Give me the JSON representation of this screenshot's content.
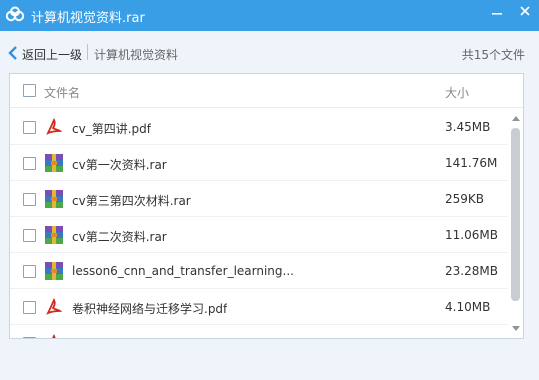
{
  "window": {
    "title": "计算机视觉资料.rar"
  },
  "nav": {
    "back_label": "返回上一级",
    "current_folder": "计算机视觉资料",
    "file_count": "共15个文件"
  },
  "table": {
    "col_name": "文件名",
    "col_size": "大小",
    "rows": [
      {
        "name": "cv_第四讲.pdf",
        "size": "3.45MB",
        "icon": "pdf-icon"
      },
      {
        "name": "cv第一次资料.rar",
        "size": "141.76M",
        "icon": "rar-icon"
      },
      {
        "name": "cv第三第四次材料.rar",
        "size": "259KB",
        "icon": "rar-icon"
      },
      {
        "name": "cv第二次资料.rar",
        "size": "11.06MB",
        "icon": "rar-icon"
      },
      {
        "name": "lesson6_cnn_and_transfer_learning...",
        "size": "23.28MB",
        "icon": "rar-icon"
      },
      {
        "name": "卷积神经网络与迁移学习.pdf",
        "size": "4.10MB",
        "icon": "pdf-icon"
      },
      {
        "name": "",
        "size": "",
        "icon": "pdf-icon"
      }
    ]
  },
  "colors": {
    "titlebar": "#3a9ee6",
    "background": "#eef4fa",
    "pdf_red": "#d42a1e",
    "rar_blue": "#3b78c4"
  }
}
